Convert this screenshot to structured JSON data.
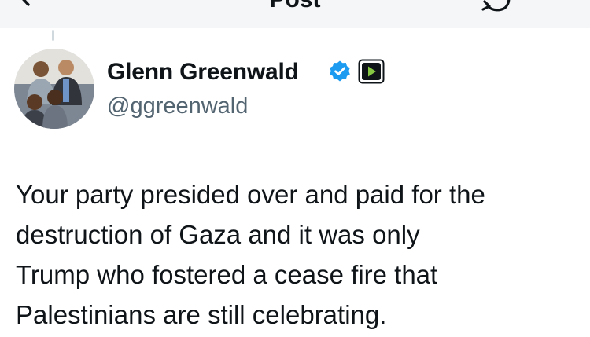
{
  "header": {
    "title": "Post",
    "back_icon": "chevron-left-icon",
    "reply_icon": "reply-icon"
  },
  "post": {
    "author": {
      "name": "Glenn Greenwald",
      "handle": "@ggreenwald",
      "verified": true,
      "badges": [
        "verified-badge-icon",
        "rumble-badge-icon"
      ]
    },
    "text_lines": [
      "Your party presided over and paid for the",
      "destruction of Gaza and it was only",
      "Trump who fostered a cease fire that",
      "Palestinians are still celebrating."
    ]
  },
  "colors": {
    "text": "#0f1419",
    "secondary_text": "#536471",
    "verified_blue": "#1d9bf0",
    "badge_green": "#85c742",
    "header_bg": "#f4f6f8"
  }
}
